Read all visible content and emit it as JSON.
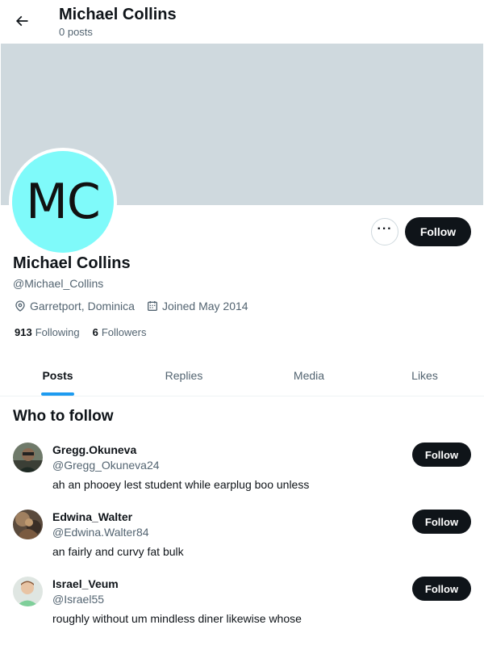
{
  "header": {
    "title": "Michael Collins",
    "subtitle": "0 posts",
    "back_icon": "arrow-left-icon"
  },
  "profile": {
    "avatar_initials": "MC",
    "avatar_color": "#7ffafa",
    "banner_color": "#cfd9de",
    "name": "Michael Collins",
    "handle": "@Michael_Collins",
    "location": "Garretport, Dominica",
    "joined": "Joined May 2014",
    "following_count": "913",
    "following_label": "Following",
    "followers_count": "6",
    "followers_label": "Followers",
    "more_icon": "more-horizontal-icon",
    "follow_label": "Follow"
  },
  "tabs": [
    {
      "label": "Posts",
      "active": true
    },
    {
      "label": "Replies",
      "active": false
    },
    {
      "label": "Media",
      "active": false
    },
    {
      "label": "Likes",
      "active": false
    }
  ],
  "who_to_follow": {
    "title": "Who to follow",
    "items": [
      {
        "name": "Gregg.Okuneva",
        "handle": "@Gregg_Okuneva24",
        "bio": "ah an phooey lest student while earplug boo unless",
        "follow_label": "Follow"
      },
      {
        "name": "Edwina_Walter",
        "handle": "@Edwina.Walter84",
        "bio": "an fairly and curvy fat bulk",
        "follow_label": "Follow"
      },
      {
        "name": "Israel_Veum",
        "handle": "@Israel55",
        "bio": "roughly without um mindless diner likewise whose",
        "follow_label": "Follow"
      }
    ]
  },
  "colors": {
    "accent": "#1d9bf0",
    "button_dark": "#0f1419",
    "secondary_text": "#536471"
  }
}
